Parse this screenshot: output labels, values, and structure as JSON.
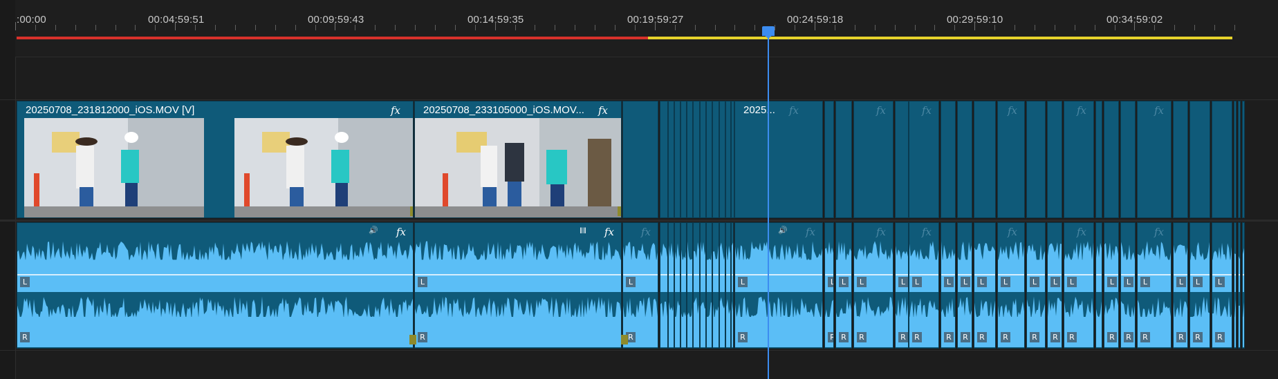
{
  "ruler": {
    "timecodes": [
      ":00:00",
      "00:04:59:51",
      "00:09:59:43",
      "00:14:59:35",
      "00:19:59:27",
      "00:24:59:18",
      "00:29:59:10",
      "00:34:59:02"
    ]
  },
  "video": {
    "clip1_name": "20250708_231812000_iOS.MOV [V]",
    "clip2_name": "20250708_233105000_iOS.MOV...",
    "clip3_name": "2025...",
    "fx_label": "fx"
  },
  "audio": {
    "left_label": "L",
    "right_label": "R",
    "fx_label": "fx"
  },
  "colors": {
    "clip": "#0f5a79",
    "waveform": "#5bbef6",
    "playhead": "#3c8cf0",
    "work_red": "#d8312b",
    "work_yellow": "#e6d22b"
  },
  "icons": [
    "playhead-icon",
    "speaker-icon",
    "waveform-icon",
    "fx-icon"
  ]
}
